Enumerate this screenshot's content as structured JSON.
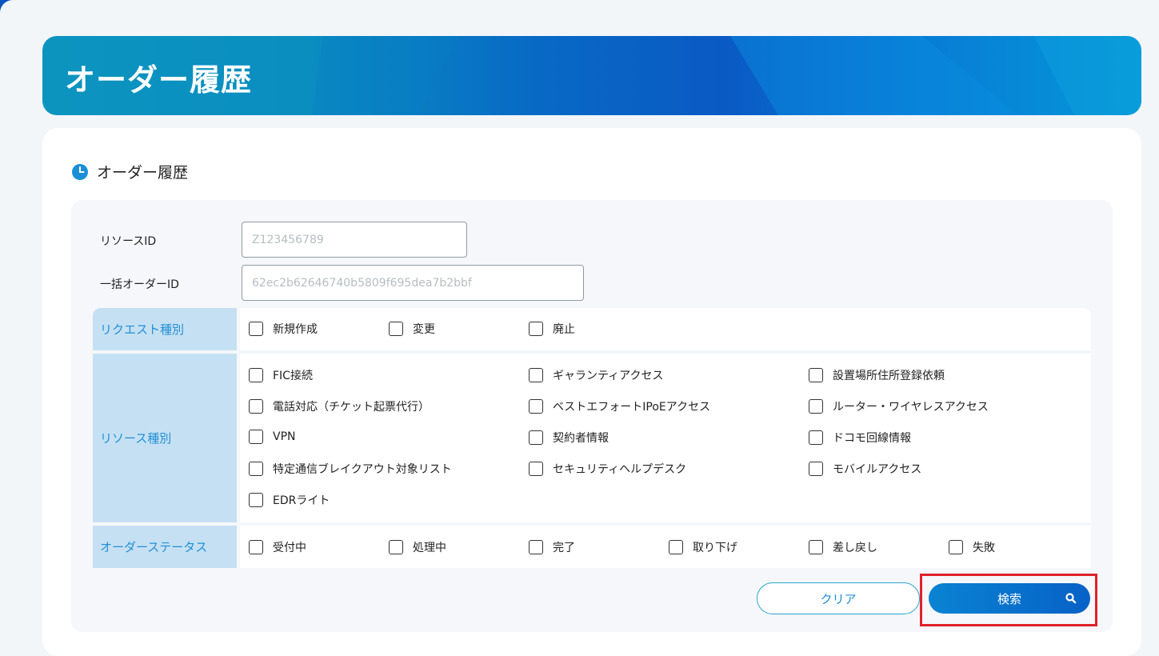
{
  "header": {
    "title": "オーダー履歴"
  },
  "section": {
    "title": "オーダー履歴",
    "icon": "clock-icon"
  },
  "fields": {
    "resource_id": {
      "label": "リソースID",
      "placeholder": "Z123456789"
    },
    "bulk_order_id": {
      "label": "一括オーダーID",
      "placeholder": "62ec2b62646740b5809f695dea7b2bbf"
    }
  },
  "request_type": {
    "label": "リクエスト種別",
    "options": [
      "新規作成",
      "変更",
      "廃止"
    ]
  },
  "resource_type": {
    "label": "リソース種別",
    "options": [
      "FIC接続",
      "ギャランティアクセス",
      "設置場所住所登録依頼",
      "電話対応（チケット起票代行）",
      "ベストエフォートIPoEアクセス",
      "ルーター・ワイヤレスアクセス",
      "VPN",
      "契約者情報",
      "ドコモ回線情報",
      "特定通信ブレイクアウト対象リスト",
      "セキュリティヘルプデスク",
      "モバイルアクセス",
      "EDRライト"
    ]
  },
  "order_status": {
    "label": "オーダーステータス",
    "options": [
      "受付中",
      "処理中",
      "完了",
      "取り下げ",
      "差し戻し",
      "失敗"
    ]
  },
  "buttons": {
    "clear": "クリア",
    "search": "検索",
    "search_icon": "search-icon"
  },
  "colors": {
    "accent": "#1f8fd6",
    "label_bg": "#c6e0f3",
    "highlight": "#e0222a"
  }
}
